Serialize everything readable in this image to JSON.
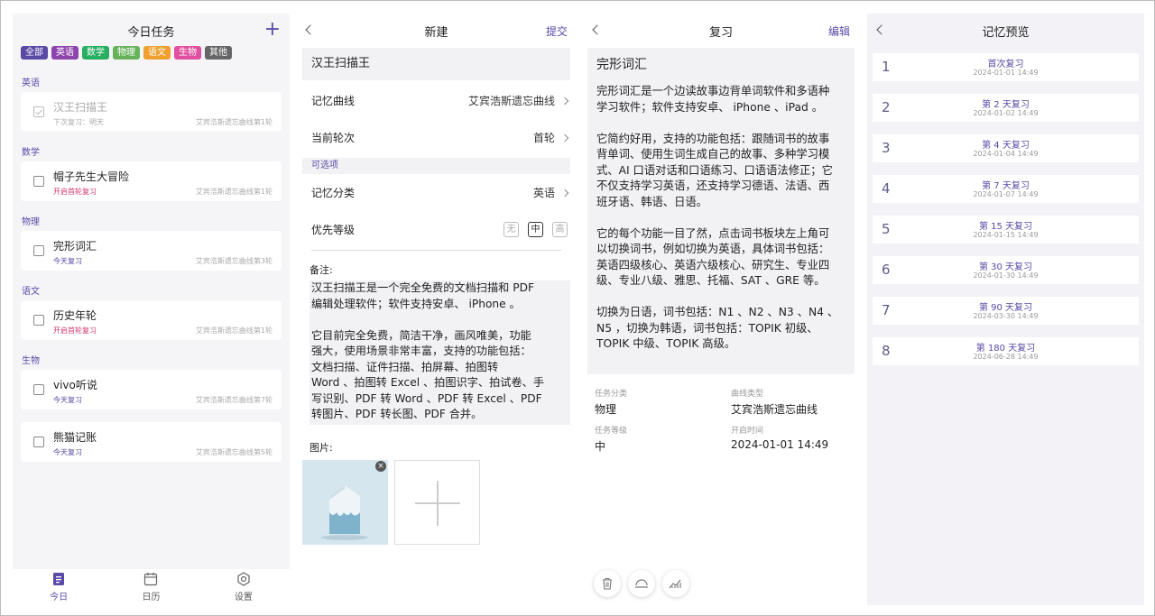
{
  "p1": {
    "title": "今日任务",
    "tags": [
      {
        "label": "全部",
        "color": "#5b49a6"
      },
      {
        "label": "英语",
        "color": "#8e44ad"
      },
      {
        "label": "数学",
        "color": "#27ae60"
      },
      {
        "label": "物理",
        "color": "#66b35c"
      },
      {
        "label": "语文",
        "color": "#f0a030"
      },
      {
        "label": "生物",
        "color": "#e04fa0"
      },
      {
        "label": "其他",
        "color": "#666666"
      }
    ],
    "sections": [
      {
        "name": "英语",
        "items": [
          {
            "name": "汉王扫描王",
            "sub": "下次复习：明天",
            "curve": "艾宾浩斯遗忘曲线第1轮"
          }
        ]
      },
      {
        "name": "数学",
        "items": [
          {
            "name": "帽子先生大冒险",
            "sub": "开启首轮复习",
            "curve": "艾宾浩斯遗忘曲线第1轮"
          }
        ]
      },
      {
        "name": "物理",
        "items": [
          {
            "name": "完形词汇",
            "sub": "今天复习",
            "curve": "艾宾浩斯遗忘曲线第3轮"
          }
        ]
      },
      {
        "name": "语文",
        "items": [
          {
            "name": "历史年轮",
            "sub": "开启首轮复习",
            "curve": "艾宾浩斯遗忘曲线第1轮"
          }
        ]
      },
      {
        "name": "生物",
        "items": [
          {
            "name": "vivo听说",
            "sub": "今天复习",
            "curve": "艾宾浩斯遗忘曲线第7轮"
          },
          {
            "name": "熊猫记账",
            "sub": "今天复习",
            "curve": "艾宾浩斯遗忘曲线第5轮"
          }
        ]
      }
    ],
    "nav": [
      "今日",
      "日历",
      "设置"
    ]
  },
  "p2": {
    "title": "新建",
    "submit": "提交",
    "name": "汉王扫描王",
    "curve_label": "记忆曲线",
    "curve_value": "艾宾浩斯遗忘曲线",
    "round_label": "当前轮次",
    "round_value": "首轮",
    "optional": "可选项",
    "category_label": "记忆分类",
    "category_value": "英语",
    "priority_label": "优先等级",
    "priority": [
      "无",
      "中",
      "高"
    ],
    "note_label": "备注:",
    "note": "汉王扫描王是一个完全免费的文档扫描和 PDF\n编辑处理软件；软件支持安卓、 iPhone 。\n\n它目前完全免费，简洁干净，画风唯美，功能\n强大，使用场景非常丰富，支持的功能包括：\n文档扫描、证件扫描、拍屏幕、拍图转\nWord 、拍图转 Excel 、拍图识字、拍试卷、手\n写识别、PDF 转 Word 、PDF 转 Excel 、PDF\n转图片、PDF 转长图、PDF 合并。",
    "image_label": "图片:"
  },
  "p3": {
    "title": "复习",
    "edit": "编辑",
    "card_title": "完形词汇",
    "card_body": "完形词汇是一个边读故事边背单词软件和多语种\n学习软件；软件支持安卓、 iPhone 、iPad 。\n\n它简约好用，支持的功能包括：跟随词书的故事\n背单词、使用生词生成自己的故事、多种学习模\n式、AI 口语对话和口语练习、口语语法修正；它\n不仅支持学习英语，还支持学习德语、法语、西\n班牙语、韩语、日语。\n\n它的每个功能一目了然，点击词书板块左上角可\n以切换词书，例如切换为英语，具体词书包括：\n英语四级核心、英语六级核心、研究生、专业四\n级、专业八级、雅思、托福、SAT 、GRE 等。\n\n切换为日语，词书包括：N1 、N2 、N3 、N4 、\nN5 ，切换为韩语，词书包括：TOPIK 初级、\nTOPIK 中级、TOPIK 高级。",
    "info": [
      {
        "k": "任务分类",
        "v": "物理"
      },
      {
        "k": "曲线类型",
        "v": "艾宾浩斯遗忘曲线"
      },
      {
        "k": "任务等级",
        "v": "中"
      },
      {
        "k": "开启时间",
        "v": "2024-01-01 14:49"
      }
    ]
  },
  "p4": {
    "title": "记忆预览",
    "rows": [
      {
        "n": "1",
        "c": "首次复习",
        "d": "2024-01-01 14:49"
      },
      {
        "n": "2",
        "c": "第 2 天复习",
        "d": "2024-01-02 14:49"
      },
      {
        "n": "3",
        "c": "第 4 天复习",
        "d": "2024-01-04 14:49"
      },
      {
        "n": "4",
        "c": "第 7 天复习",
        "d": "2024-01-07 14:49"
      },
      {
        "n": "5",
        "c": "第 15 天复习",
        "d": "2024-01-15 14:49"
      },
      {
        "n": "6",
        "c": "第 30 天复习",
        "d": "2024-01-30 14:49"
      },
      {
        "n": "7",
        "c": "第 90 天复习",
        "d": "2024-03-30 14:49"
      },
      {
        "n": "8",
        "c": "第 180 天复习",
        "d": "2024-06-28 14:49"
      }
    ]
  }
}
